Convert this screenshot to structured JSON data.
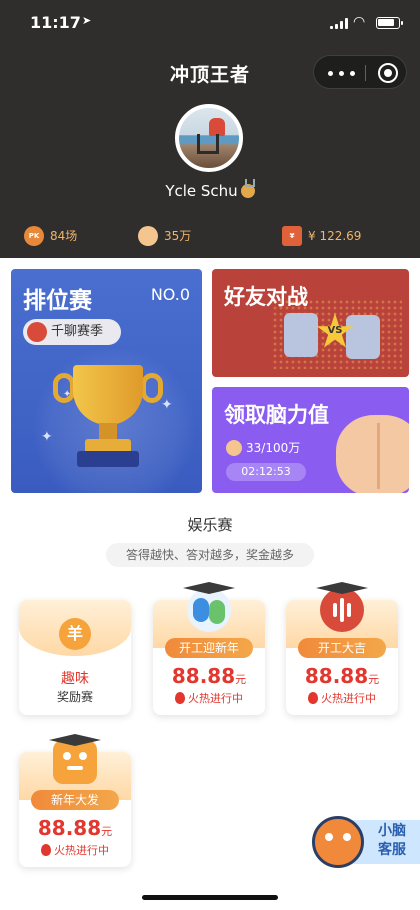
{
  "status_bar": {
    "time": "11:17",
    "location_glyph": "➤"
  },
  "nav": {
    "title": "冲顶王者"
  },
  "profile": {
    "username": "Ycle Schu"
  },
  "stats": [
    {
      "icon": "PK",
      "label": "84场"
    },
    {
      "icon": "brain",
      "label": "35万"
    },
    {
      "icon": "¥",
      "label": "¥ 122.69"
    }
  ],
  "ranked": {
    "title": "排位赛",
    "number": "NO.0",
    "season_label": "千聊赛季"
  },
  "friends_battle": {
    "title": "好友对战",
    "vs_label": "VS"
  },
  "brain_power": {
    "title": "领取脑力值",
    "progress_text": "33/100万",
    "timer": "02:12:53"
  },
  "entertainment": {
    "section_title": "娱乐赛",
    "tagline": "答得越快、答对越多，奖金越多",
    "fun_reward": {
      "line1": "趣味",
      "line2": "奖励赛",
      "icon": "羊"
    },
    "games": [
      {
        "name": "开工迎新年",
        "prize": "88.88",
        "unit": "元",
        "status": "火热进行中"
      },
      {
        "name": "开工大吉",
        "prize": "88.88",
        "unit": "元",
        "status": "火热进行中"
      },
      {
        "name": "新年大发",
        "prize": "88.88",
        "unit": "元",
        "status": "火热进行中"
      }
    ]
  },
  "helper": {
    "line1": "小脑",
    "line2": "客服"
  },
  "colors": {
    "accent_red": "#e2372e",
    "header_dark": "#2f2e2c",
    "stat_gold": "#f0b46a"
  }
}
